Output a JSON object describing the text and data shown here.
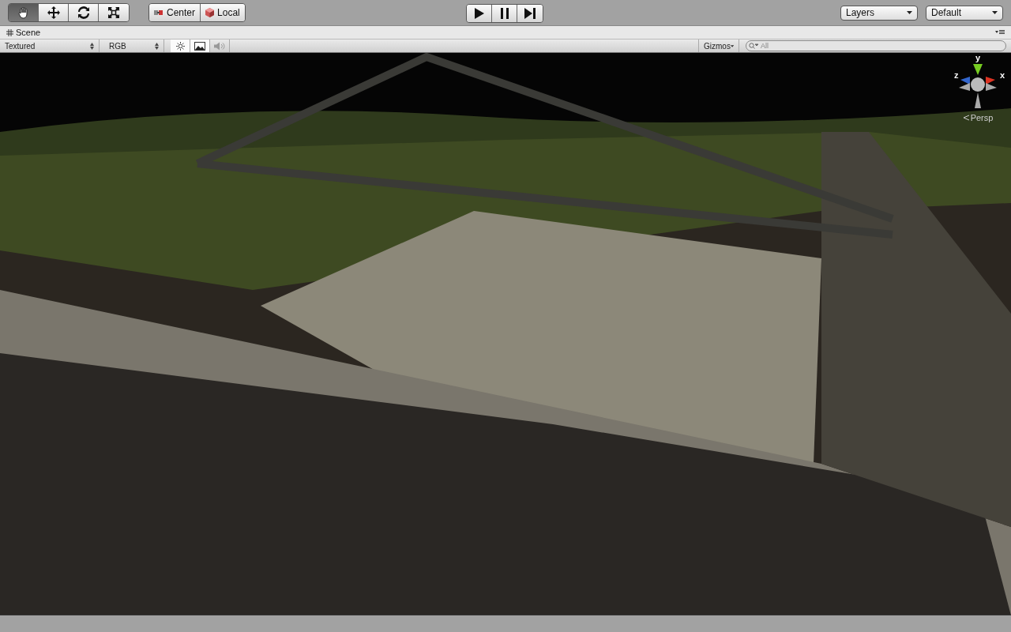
{
  "toolbar": {
    "tools": [
      {
        "kind": "hand",
        "selected": true
      },
      {
        "kind": "move",
        "selected": false
      },
      {
        "kind": "rotate",
        "selected": false
      },
      {
        "kind": "scale",
        "selected": false
      }
    ],
    "pivot": [
      {
        "kind": "pivot",
        "label": "Center"
      },
      {
        "kind": "rotation",
        "label": "Local"
      }
    ],
    "playback": [
      {
        "kind": "play",
        "selected": false
      },
      {
        "kind": "pause",
        "selected": false
      },
      {
        "kind": "step",
        "selected": false
      }
    ],
    "dropdowns": [
      {
        "label": "Layers"
      },
      {
        "label": "Default"
      }
    ]
  },
  "scene_tab": {
    "label": "Scene"
  },
  "scene_toolbar": {
    "render_mode": "Textured",
    "channel": "RGB",
    "toggles": [
      {
        "kind": "lighting",
        "on": true
      },
      {
        "kind": "image",
        "on": true
      },
      {
        "kind": "audio",
        "on": false
      }
    ],
    "gizmos": "Gizmos",
    "search": {
      "placeholder": "All"
    }
  },
  "scene_view": {
    "gizmo": {
      "y": "y",
      "z": "z",
      "x": "x"
    },
    "projection": "Persp"
  }
}
